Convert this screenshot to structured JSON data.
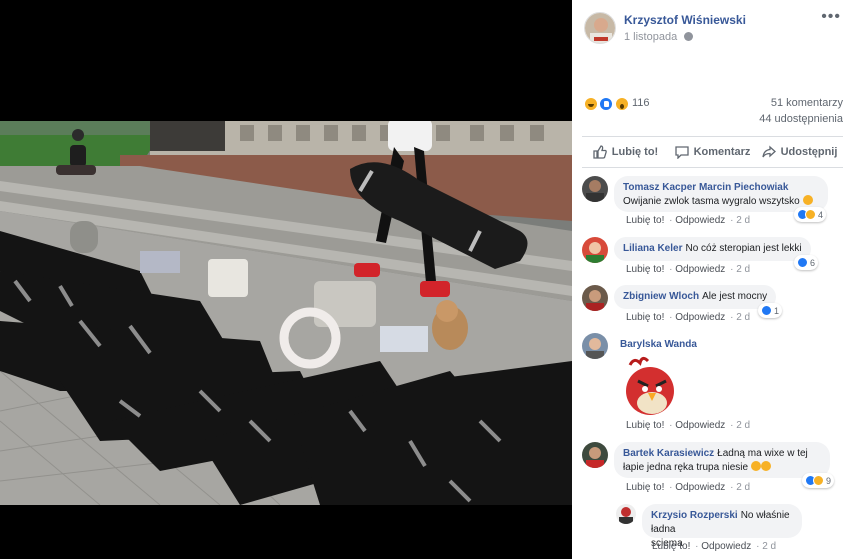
{
  "post": {
    "author": "Krzysztof Wiśniewski",
    "date": "1 listopada",
    "more_label": "•••"
  },
  "stats": {
    "reaction_icons": [
      "haha",
      "like",
      "wow"
    ],
    "reactions": "116",
    "comments": "51 komentarzy",
    "shares": "44 udostępnienia"
  },
  "actions": {
    "like": "Lubię to!",
    "comment": "Komentarz",
    "share": "Udostępnij"
  },
  "comments": [
    {
      "name": "Tomasz Kacper Marcin Piechowiak",
      "text": "Owijanie zwlok tasma wygralo wszytsko",
      "has_emoji": true,
      "reactions": "4",
      "like": "Lubię to!",
      "reply": "Odpowiedz",
      "time": "2 d"
    },
    {
      "name": "Liliana Keler",
      "text": "No cóż steropian jest lekki",
      "reactions": "6",
      "like": "Lubię to!",
      "reply": "Odpowiedz",
      "time": "2 d"
    },
    {
      "name": "Zbigniew Wloch",
      "text": "Ale jest mocny",
      "reactions": "1",
      "like": "Lubię to!",
      "reply": "Odpowiedz",
      "time": "2 d"
    },
    {
      "name": "Barylska Wanda",
      "sticker": "angry-bird-sticker",
      "like": "Lubię to!",
      "reply": "Odpowiedz",
      "time": "2 d"
    },
    {
      "name": "Bartek Karasiewicz",
      "text_line1": "Ładną ma wixe w tej",
      "text_line2": "łapie jedna ręka trupa niesie",
      "reactions": "9",
      "like": "Lubię to!",
      "reply": "Odpowiedz",
      "time": "2 d"
    },
    {
      "name": "Krzysio Rozperski",
      "text_line1": "No właśnie ładna",
      "text_line2": "sciema",
      "like": "Lubię to!",
      "reply": "Odpowiedz",
      "time": "2 d"
    }
  ],
  "colors": {
    "link": "#385898",
    "meta": "#90949c",
    "bubble": "#f2f3f5",
    "like_blue": "#2078f4",
    "emoji_yellow": "#f7b125"
  }
}
